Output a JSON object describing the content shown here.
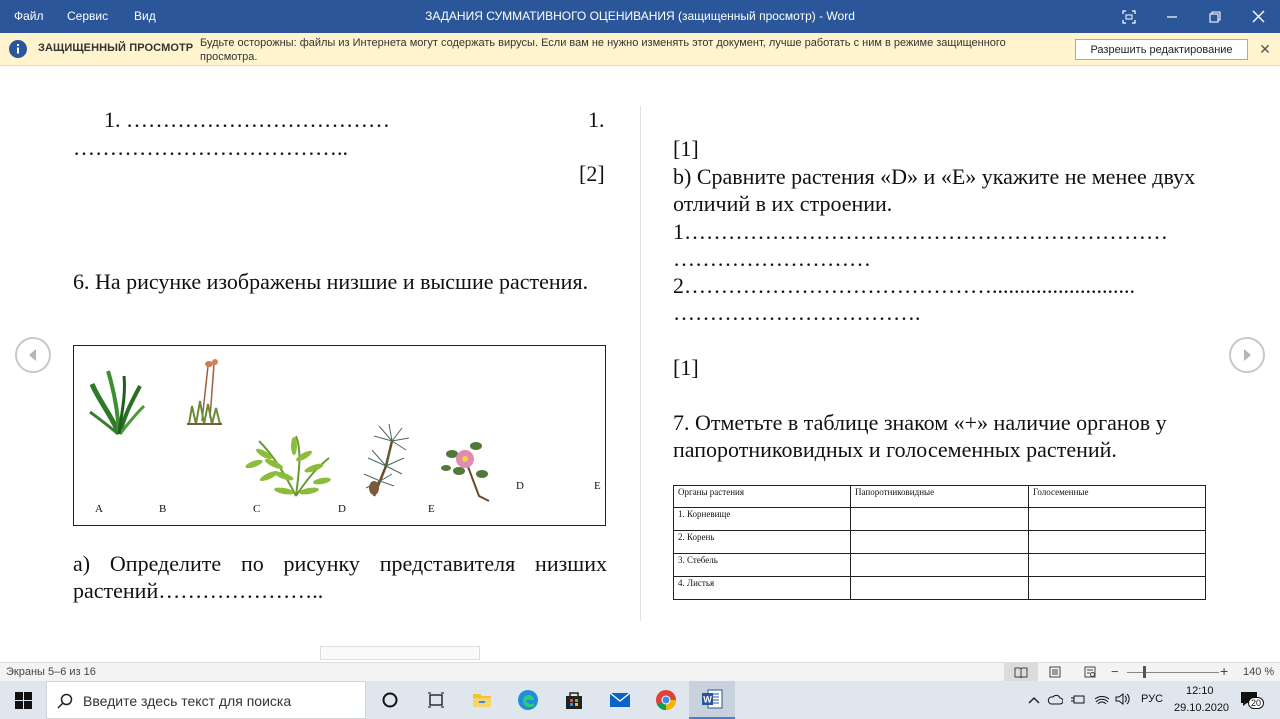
{
  "titlebar": {
    "menu": [
      "Файл",
      "Сервис",
      "Вид"
    ],
    "title": "ЗАДАНИЯ СУММАТИВНОГО ОЦЕНИВАНИЯ (защищенный просмотр) - Word"
  },
  "protected_view": {
    "label": "ЗАЩИЩЕННЫЙ ПРОСМОТР",
    "message": "Будьте осторожны: файлы из Интернета могут содержать вирусы. Если вам не нужно изменять этот документ, лучше работать с ним в режиме защищенного просмотра.",
    "button": "Разрешить редактирование",
    "close": "✕"
  },
  "left_page": {
    "line1": "1. ………………………………",
    "line1_right": "1.",
    "line2": "………………………………..",
    "score1": "[2]",
    "q6": "6. На рисунке изображены низшие и высшие растения.",
    "qa": "а) Определите по рисунку представителя низших растений…………………..",
    "figure_labels": [
      "A",
      "B",
      "C",
      "D",
      "E",
      "D",
      "E"
    ]
  },
  "right_page": {
    "score1": "[1]",
    "qb": "b) Сравните растения «D» и «E» укажите не менее двух отличий в их строении.",
    "ans1a": "1…………………………………………………………",
    "ans1b": "………………………",
    "ans2a": "2……………………………………..........................",
    "ans2b": "…………………………….",
    "score2": "[1]",
    "q7": "7. Отметьте в таблице знаком «+» наличие органов у папоротниковидных и голосеменных растений.",
    "table_header": [
      "Органы растения",
      "Папоротниковидные",
      "Голосеменные"
    ],
    "table_rows": [
      "1. Корневище",
      "2. Корень",
      "3. Стебель",
      "4. Листья"
    ]
  },
  "statusbar": {
    "pages": "Экраны 5–6 из 16",
    "zoom": "140 %"
  },
  "taskbar": {
    "search_placeholder": "Введите здесь текст для поиска",
    "lang": "РУС",
    "time": "12:10",
    "date": "29.10.2020",
    "notifications": "20"
  },
  "colors": {
    "word_blue": "#2b579a",
    "protected_bg": "#fff4ce",
    "taskbar_bg": "#dfe6ee"
  }
}
